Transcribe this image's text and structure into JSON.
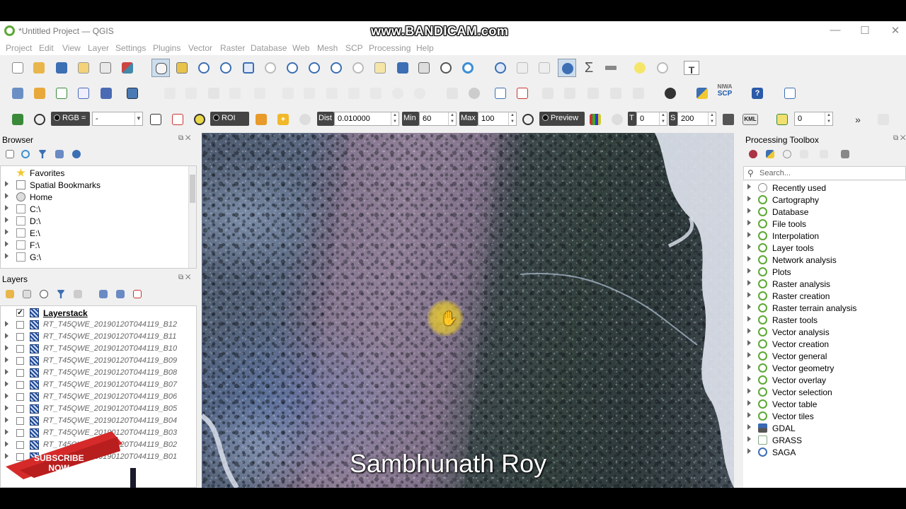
{
  "app": {
    "title": "*Untitled Project — QGIS",
    "watermark": "www.BANDICAM.com"
  },
  "menu": [
    "Project",
    "Edit",
    "View",
    "Layer",
    "Settings",
    "Plugins",
    "Vector",
    "Raster",
    "Database",
    "Web",
    "Mesh",
    "SCP",
    "Processing",
    "Help"
  ],
  "scp_toolbar": {
    "rgb_label": "RGB =",
    "rgb_value": "-",
    "roi_label": "ROI",
    "dist_label": "Dist",
    "dist_value": "0.010000",
    "min_label": "Min",
    "min_value": "60",
    "max_label": "Max",
    "max_value": "100",
    "preview_label": "Preview",
    "t_label": "T",
    "t_value": "0",
    "s_label": "S",
    "s_value": "200",
    "kml_label": "KML",
    "band_value": "0",
    "nrca_label": "NIWA",
    "scp_label": "SCP"
  },
  "browser": {
    "title": "Browser",
    "items": [
      {
        "label": "Favorites",
        "icon": "star-icon"
      },
      {
        "label": "Spatial Bookmarks",
        "icon": "bookmark-icon"
      },
      {
        "label": "Home",
        "icon": "home-icon"
      },
      {
        "label": "C:\\",
        "icon": "folder-icon"
      },
      {
        "label": "D:\\",
        "icon": "folder-icon"
      },
      {
        "label": "E:\\",
        "icon": "folder-icon"
      },
      {
        "label": "F:\\",
        "icon": "folder-icon"
      },
      {
        "label": "G:\\",
        "icon": "folder-icon"
      }
    ]
  },
  "layers": {
    "title": "Layers",
    "items": [
      {
        "label": "Layerstack",
        "checked": true
      },
      {
        "label": "RT_T45QWE_20190120T044119_B12",
        "checked": false
      },
      {
        "label": "RT_T45QWE_20190120T044119_B11",
        "checked": false
      },
      {
        "label": "RT_T45QWE_20190120T044119_B10",
        "checked": false
      },
      {
        "label": "RT_T45QWE_20190120T044119_B09",
        "checked": false
      },
      {
        "label": "RT_T45QWE_20190120T044119_B08",
        "checked": false
      },
      {
        "label": "RT_T45QWE_20190120T044119_B07",
        "checked": false
      },
      {
        "label": "RT_T45QWE_20190120T044119_B06",
        "checked": false
      },
      {
        "label": "RT_T45QWE_20190120T044119_B05",
        "checked": false
      },
      {
        "label": "RT_T45QWE_20190120T044119_B04",
        "checked": false
      },
      {
        "label": "RT_T45QWE_20190120T044119_B03",
        "checked": false
      },
      {
        "label": "RT_T45QWE_20190120T044119_B02",
        "checked": false
      },
      {
        "label": "RT_T45QWE_20190120T044119_B01",
        "checked": false
      }
    ]
  },
  "processing": {
    "title": "Processing Toolbox",
    "search_placeholder": "Search...",
    "items": [
      {
        "label": "Recently used",
        "icon": "clock-icon"
      },
      {
        "label": "Cartography",
        "icon": "qgis-icon"
      },
      {
        "label": "Database",
        "icon": "qgis-icon"
      },
      {
        "label": "File tools",
        "icon": "qgis-icon"
      },
      {
        "label": "Interpolation",
        "icon": "qgis-icon"
      },
      {
        "label": "Layer tools",
        "icon": "qgis-icon"
      },
      {
        "label": "Network analysis",
        "icon": "qgis-icon"
      },
      {
        "label": "Plots",
        "icon": "qgis-icon"
      },
      {
        "label": "Raster analysis",
        "icon": "qgis-icon"
      },
      {
        "label": "Raster creation",
        "icon": "qgis-icon"
      },
      {
        "label": "Raster terrain analysis",
        "icon": "qgis-icon"
      },
      {
        "label": "Raster tools",
        "icon": "qgis-icon"
      },
      {
        "label": "Vector analysis",
        "icon": "qgis-icon"
      },
      {
        "label": "Vector creation",
        "icon": "qgis-icon"
      },
      {
        "label": "Vector general",
        "icon": "qgis-icon"
      },
      {
        "label": "Vector geometry",
        "icon": "qgis-icon"
      },
      {
        "label": "Vector overlay",
        "icon": "qgis-icon"
      },
      {
        "label": "Vector selection",
        "icon": "qgis-icon"
      },
      {
        "label": "Vector table",
        "icon": "qgis-icon"
      },
      {
        "label": "Vector tiles",
        "icon": "qgis-icon"
      },
      {
        "label": "GDAL",
        "icon": "gdal-icon"
      },
      {
        "label": "GRASS",
        "icon": "grass-icon"
      },
      {
        "label": "SAGA",
        "icon": "saga-icon"
      }
    ]
  },
  "overlay": {
    "credit": "Sambhunath Roy",
    "subscribe_line1": "SUBSCRIBE",
    "subscribe_line2": "NOW"
  },
  "colors": {
    "qgis_green": "#5da836",
    "subscribe_red": "#d62a2a"
  }
}
